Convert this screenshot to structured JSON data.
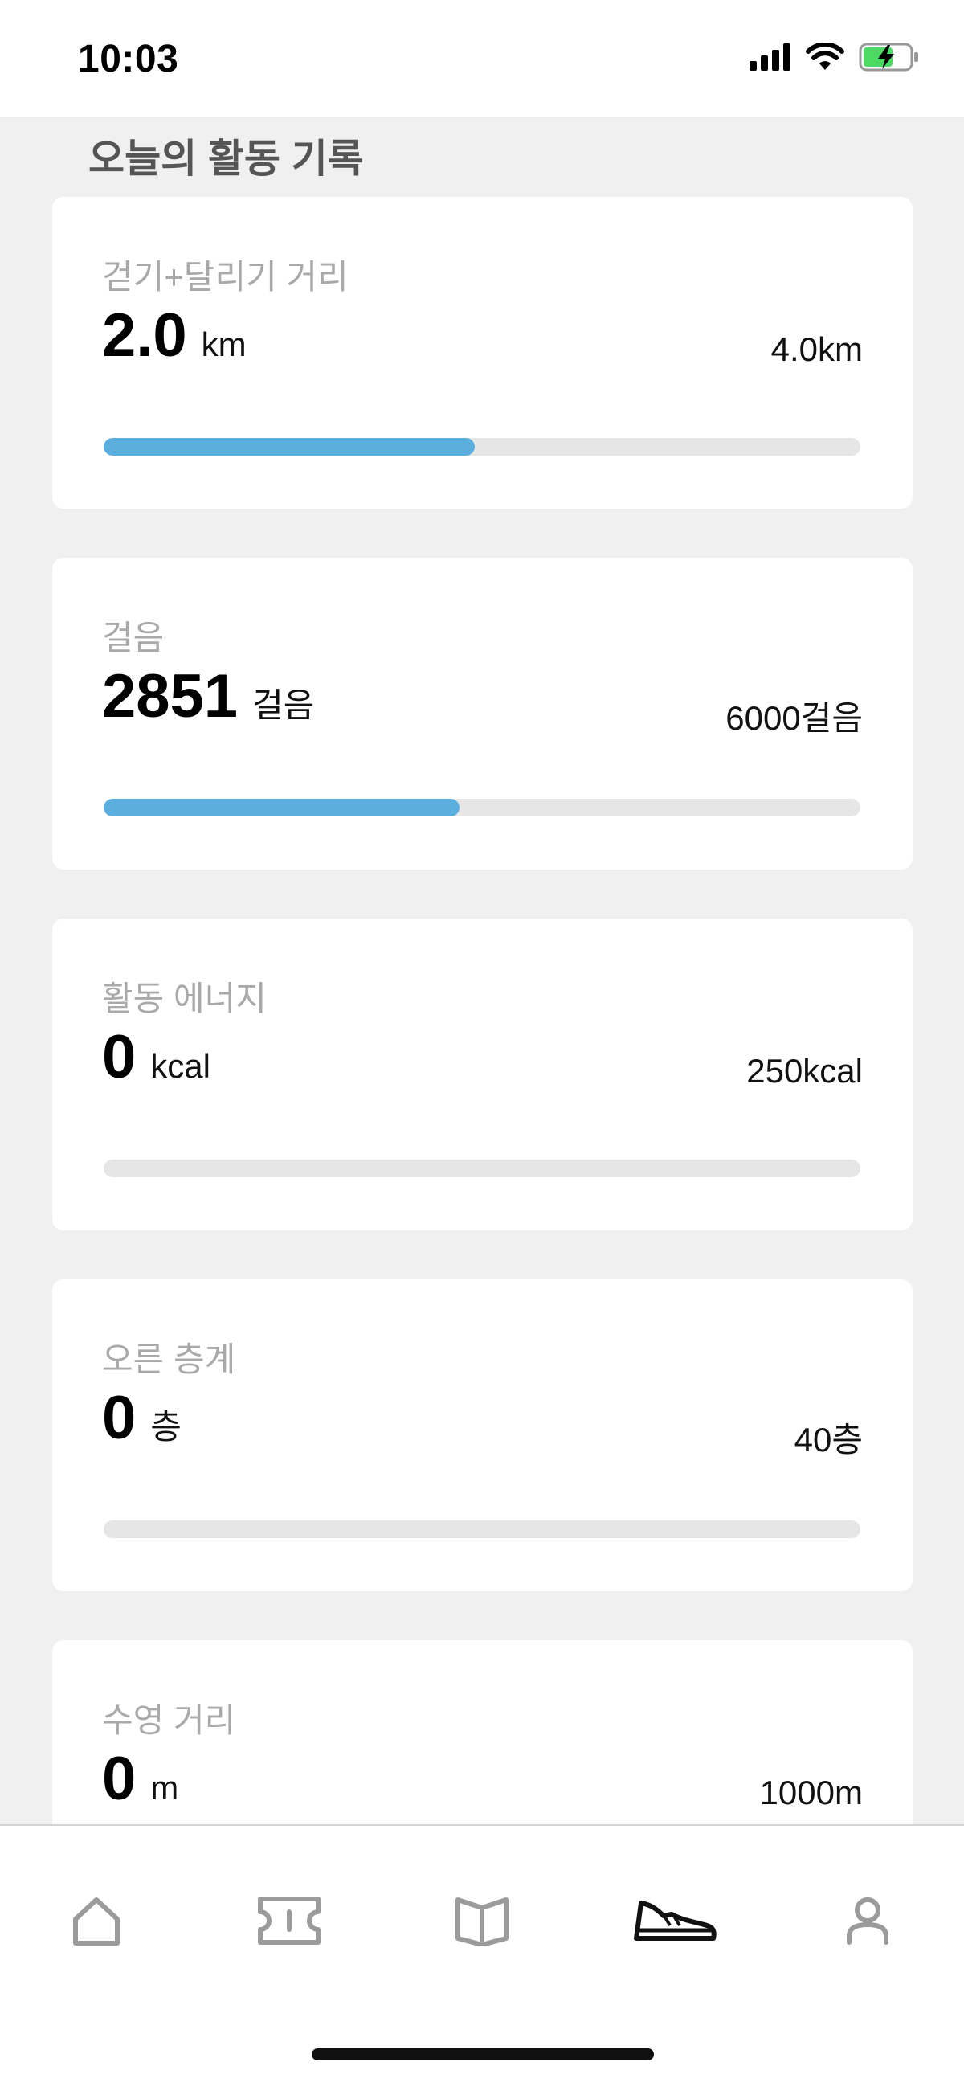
{
  "status_bar": {
    "time": "10:03",
    "icons": [
      "cellular-signal-icon",
      "wifi-icon",
      "battery-charging-icon"
    ],
    "battery_color": "#4cd964"
  },
  "page": {
    "title": "오늘의 활동 기록"
  },
  "cards": [
    {
      "label": "걷기+달리기 거리",
      "value": "2.0",
      "unit": "km",
      "goal": "4.0km",
      "progress": 0.49
    },
    {
      "label": "걸음",
      "value": "2851",
      "unit": "걸음",
      "goal": "6000걸음",
      "progress": 0.47
    },
    {
      "label": "활동 에너지",
      "value": "0",
      "unit": "kcal",
      "goal": "250kcal",
      "progress": 0
    },
    {
      "label": "오른 층계",
      "value": "0",
      "unit": "층",
      "goal": "40층",
      "progress": 0
    },
    {
      "label": "수영 거리",
      "value": "0",
      "unit": "m",
      "goal": "1000m",
      "progress": 0
    }
  ],
  "colors": {
    "accent": "#5aafde",
    "track": "#e6e6e6",
    "background": "#f0f0f0",
    "label": "#a9a9a9"
  },
  "tab_bar": {
    "tabs": [
      {
        "icon": "home-icon",
        "active": false
      },
      {
        "icon": "ticket-icon",
        "active": false
      },
      {
        "icon": "book-icon",
        "active": false
      },
      {
        "icon": "sneaker-icon",
        "active": true
      },
      {
        "icon": "person-icon",
        "active": false
      }
    ]
  }
}
